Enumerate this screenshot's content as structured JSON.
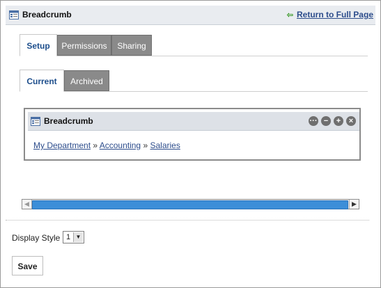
{
  "header": {
    "title": "Breadcrumb",
    "return_link": "Return to Full Page",
    "icon": "portlet-icon"
  },
  "main_tabs": [
    {
      "label": "Setup",
      "active": true
    },
    {
      "label": "Permissions",
      "active": false
    },
    {
      "label": "Sharing",
      "active": false
    }
  ],
  "sub_tabs": [
    {
      "label": "Current",
      "active": true
    },
    {
      "label": "Archived",
      "active": false
    }
  ],
  "portlet": {
    "title": "Breadcrumb",
    "controls": [
      "more-icon",
      "minimize-icon",
      "maximize-icon",
      "close-icon"
    ],
    "breadcrumb": {
      "items": [
        "My Department",
        "Accounting",
        "Salaries"
      ],
      "separator": "»"
    }
  },
  "display_style": {
    "label": "Display Style",
    "selected": "1"
  },
  "save_label": "Save",
  "colors": {
    "active_tab_text": "#1d4e8c",
    "inactive_tab_bg": "#8a8a8a",
    "link": "#2d4d8c",
    "return_arrow": "#3d9a2c",
    "scroll_thumb": "#3c8ed8"
  }
}
